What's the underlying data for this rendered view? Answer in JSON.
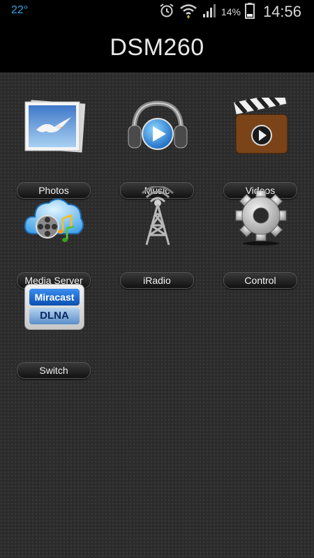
{
  "status_bar": {
    "temperature": "22°",
    "battery_percent": "14%",
    "time": "14:56",
    "icons": [
      "alarm-icon",
      "wifi-icon",
      "signal-icon",
      "battery-icon"
    ]
  },
  "app": {
    "title": "DSM260"
  },
  "tiles": [
    {
      "label": "Photos",
      "icon": "photos-icon"
    },
    {
      "label": "Music",
      "icon": "music-icon"
    },
    {
      "label": "Videos",
      "icon": "videos-icon"
    },
    {
      "label": "Media Server",
      "icon": "media-server-icon"
    },
    {
      "label": "iRadio",
      "icon": "iradio-icon"
    },
    {
      "label": "Control",
      "icon": "control-icon"
    },
    {
      "label": "Switch",
      "icon": "switch-icon",
      "icon_text_top": "Miracast",
      "icon_text_bottom": "DLNA"
    }
  ]
}
